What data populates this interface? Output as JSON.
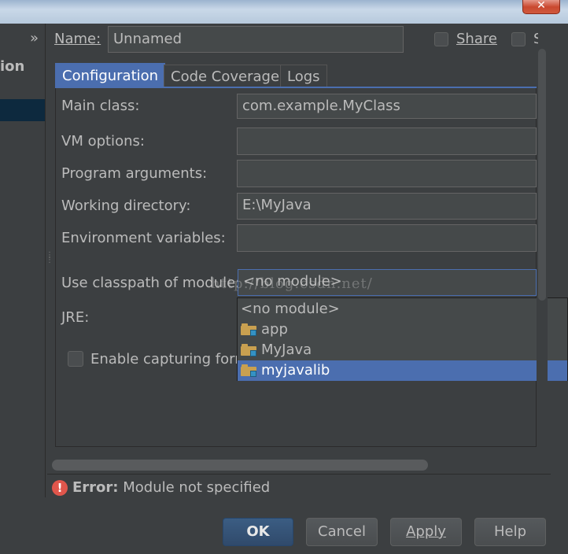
{
  "titlebar": {
    "close_glyph": "✕"
  },
  "left_panel": {
    "label": "ion",
    "expand_glyph": "»"
  },
  "header": {
    "name_label": "Name:",
    "name_value": "Unnamed",
    "share_label": "Share",
    "single_instance_label": "S"
  },
  "tabs": [
    {
      "label": "Configuration",
      "active": true
    },
    {
      "label": "Code Coverage",
      "active": false
    },
    {
      "label": "Logs",
      "active": false
    }
  ],
  "form": {
    "main_class_label": "Main class:",
    "main_class_value": "com.example.MyClass",
    "vm_options_label": "VM options:",
    "vm_options_value": "",
    "program_arguments_label": "Program arguments:",
    "program_arguments_value": "",
    "working_directory_label": "Working directory:",
    "working_directory_value": "E:\\MyJava",
    "environment_variables_label": "Environment variables:",
    "environment_variables_value": "",
    "classpath_module_label": "Use classpath of module:",
    "classpath_module_value": "<no module>",
    "jre_label": "JRE:",
    "enable_capturing_label": "Enable capturing form"
  },
  "module_dropdown": {
    "options": [
      {
        "label": "<no module>",
        "icon": "",
        "selected": false
      },
      {
        "label": "app",
        "icon": "module-folder-icon",
        "selected": false
      },
      {
        "label": "MyJava",
        "icon": "module-folder-icon",
        "selected": false
      },
      {
        "label": "myjavalib",
        "icon": "module-folder-icon",
        "selected": true
      }
    ]
  },
  "watermark": "http://blog.csdn.net/",
  "status": {
    "error_prefix": "Error:",
    "error_message": "Module not specified",
    "icon": "error-icon"
  },
  "buttons": {
    "ok": "OK",
    "cancel": "Cancel",
    "apply": "Apply",
    "help": "Help"
  },
  "colors": {
    "background": "#3c3f41",
    "accent": "#4b6eaf",
    "error": "#e0564c",
    "field": "#45494a"
  }
}
